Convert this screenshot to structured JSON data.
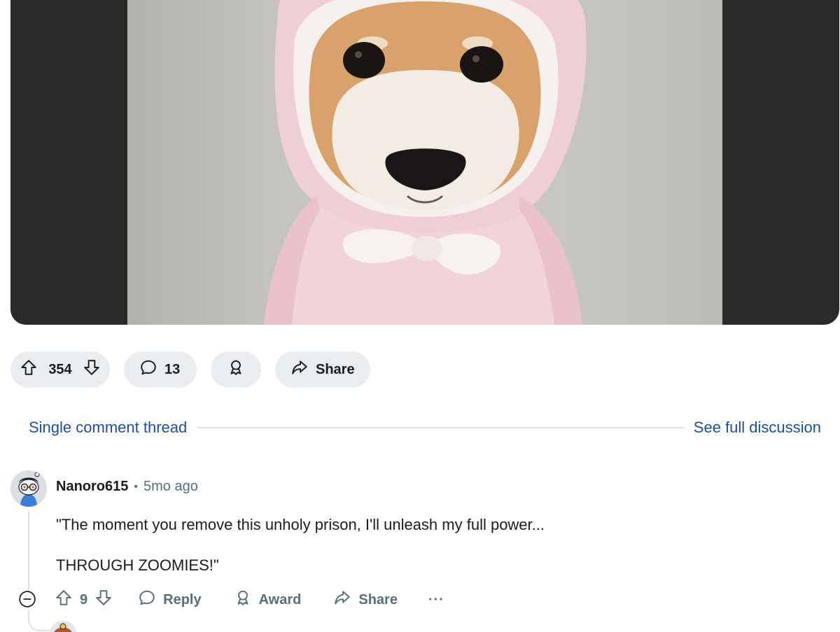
{
  "post": {
    "image_alt": "Shiba inu dog wearing a pink fleece hoodie with a bow",
    "vote_count": "354",
    "comment_count": "13",
    "share_label": "Share"
  },
  "thread": {
    "single_label": "Single comment thread",
    "full_label": "See full discussion"
  },
  "comment": {
    "author": "Nanoro615",
    "separator": "•",
    "time": "5mo ago",
    "body": [
      "\"The moment you remove this unholy prison, I'll unleash my full power...",
      "THROUGH ZOOMIES!\""
    ],
    "votes": "9",
    "reply_label": "Reply",
    "award_label": "Award",
    "share_label": "Share",
    "more_label": "···"
  },
  "colors": {
    "link": "#1a4ea6",
    "pill_bg": "#eaedef",
    "meta": "#576f76",
    "media_bg": "#2b2a28"
  }
}
